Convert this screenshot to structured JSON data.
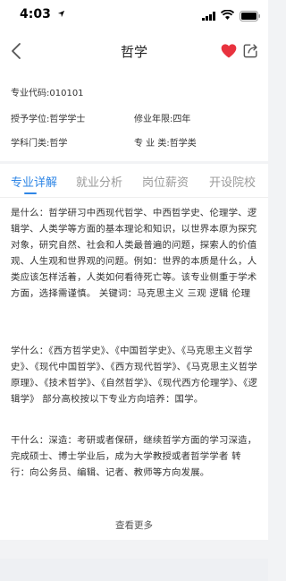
{
  "status": {
    "time": "4:03"
  },
  "nav": {
    "title": "哲学"
  },
  "info": {
    "code": "专业代码:010101",
    "degree": "授予学位:哲学学士",
    "years": "修业年限:四年",
    "category": "学科门类:哲学",
    "class": "专  业  类:哲学类"
  },
  "tabs": [
    {
      "label": "专业详解",
      "active": true
    },
    {
      "label": "就业分析"
    },
    {
      "label": "岗位薪资"
    },
    {
      "label": "开设院校"
    }
  ],
  "content": {
    "what": "是什么：哲学研习中西现代哲学、中西哲学史、伦理学、逻辑学、人类学等方面的基本理论和知识，以世界本原为探究对象，研究自然、社会和人类最普遍的问题，探索人的价值观、人生观和世界观的问题。例如：世界的本质是什么，人类应该怎样活着，人类如何看待死亡等。该专业侧重于学术方面，选择需谨慎。 关键词：马克思主义 三观 逻辑 伦理",
    "learn": "学什么：《西方哲学史》、《中国哲学史》、《马克思主义哲学史》、《现代中国哲学》、《西方现代哲学》、《马克思主义哲学原理》、《技术哲学》、《自然哲学》、《现代西方伦理学》、《逻辑学》 部分高校按以下专业方向培养：国学。",
    "do": "干什么：深造：考研或者保研，继续哲学方面的学习深造，完成硕士、博士学业后，成为大学教授或者哲学学者  转行：向公务员、编辑、记者、教师等方向发展。"
  },
  "more_label": "查看更多",
  "colors": {
    "accent": "#2f86e6",
    "heart": "#e8323e"
  }
}
